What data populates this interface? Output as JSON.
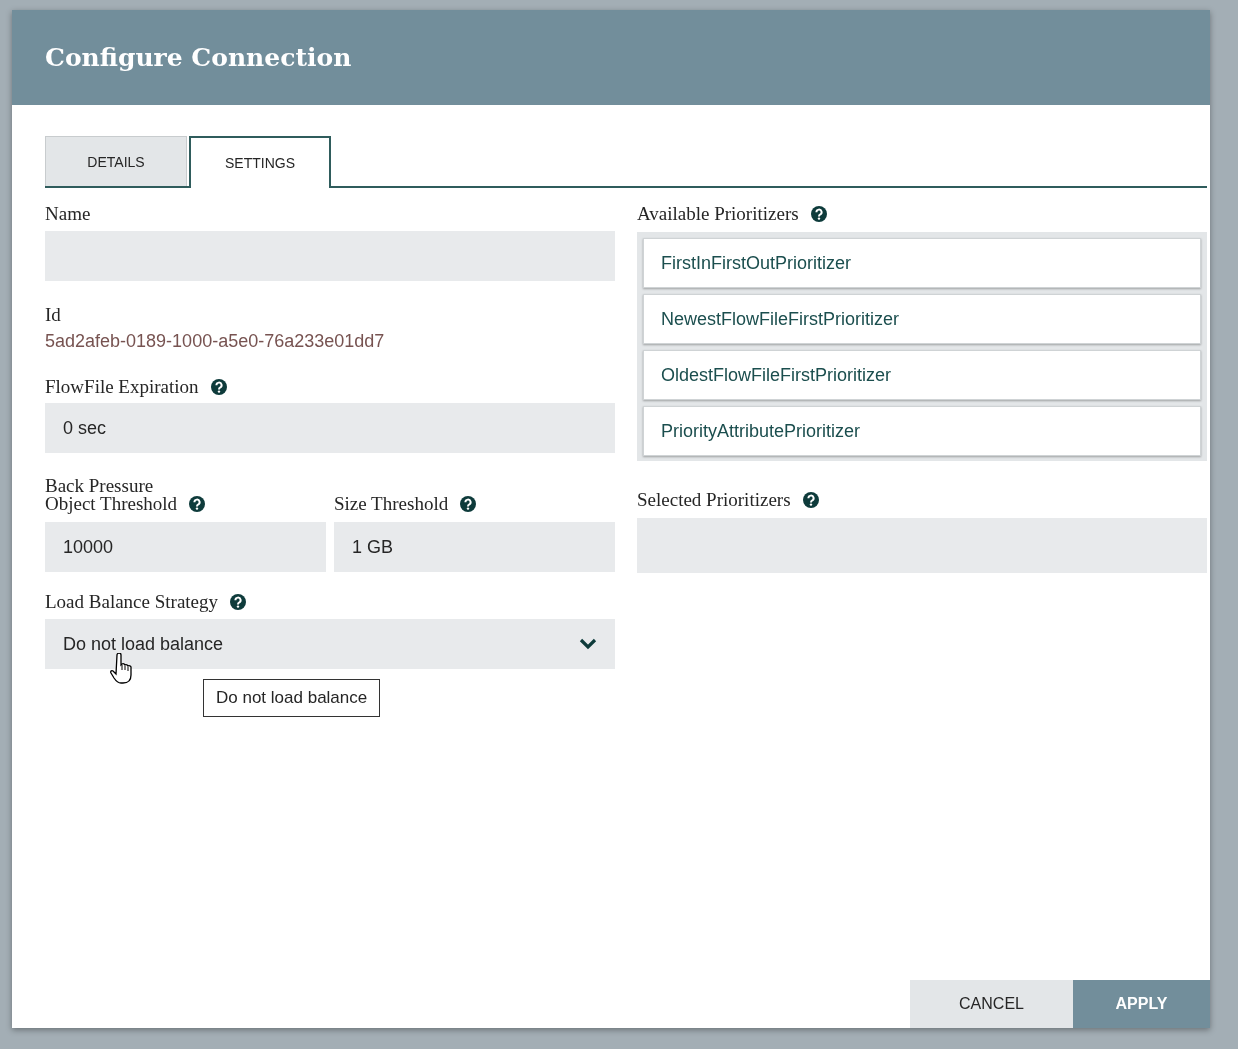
{
  "dialog": {
    "title": "Configure Connection"
  },
  "tabs": [
    {
      "label": "DETAILS",
      "selected": false
    },
    {
      "label": "SETTINGS",
      "selected": true
    }
  ],
  "name": {
    "label": "Name"
  },
  "id": {
    "label": "Id",
    "value": "5ad2afeb-0189-1000-a5e0-76a233e01dd7"
  },
  "flowfile_expiration": {
    "label": "FlowFile Expiration",
    "value": "0 sec"
  },
  "back_pressure": {
    "heading": "Back Pressure",
    "object_threshold": {
      "label": "Object Threshold",
      "value": "10000"
    },
    "size_threshold": {
      "label": "Size Threshold",
      "value": "1 GB"
    }
  },
  "load_balance_strategy": {
    "label": "Load Balance Strategy",
    "value": "Do not load balance",
    "tooltip": "Do not load balance"
  },
  "available_prioritizers": {
    "label": "Available Prioritizers",
    "items": [
      "FirstInFirstOutPrioritizer",
      "NewestFlowFileFirstPrioritizer",
      "OldestFlowFileFirstPrioritizer",
      "PriorityAttributePrioritizer"
    ]
  },
  "selected_prioritizers": {
    "label": "Selected Prioritizers"
  },
  "buttons": [
    {
      "label": "CANCEL",
      "kind": "secondary"
    },
    {
      "label": "APPLY",
      "kind": "primary"
    }
  ]
}
